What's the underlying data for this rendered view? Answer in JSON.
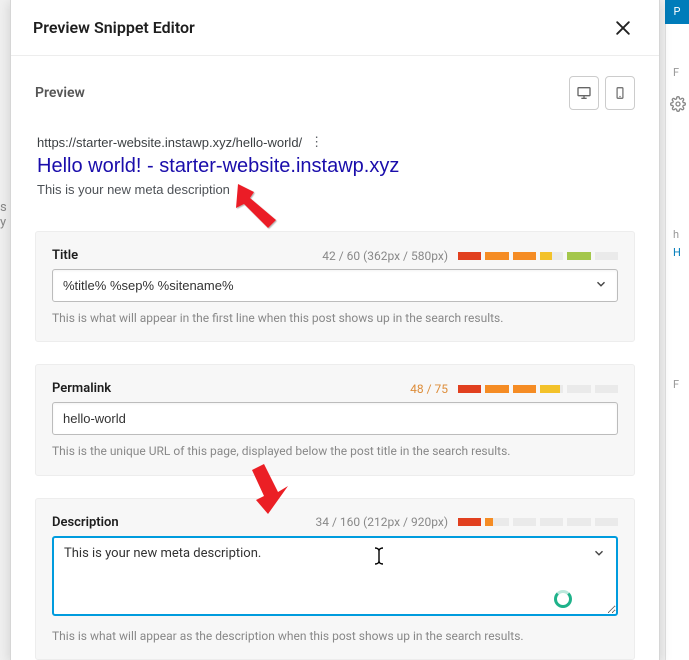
{
  "header": {
    "title": "Preview Snippet Editor"
  },
  "preview": {
    "heading": "Preview"
  },
  "serp": {
    "url": "https://starter-website.instawp.xyz/hello-world/",
    "title": "Hello world! - starter-website.instawp.xyz",
    "description": "This is your new meta description"
  },
  "title_panel": {
    "label": "Title",
    "count": "42 / 60 (362px / 580px)",
    "value": "%title% %sep% %sitename%",
    "help": "This is what will appear in the first line when this post shows up in the search results."
  },
  "permalink_panel": {
    "label": "Permalink",
    "count": "48 / 75",
    "value": "hello-world",
    "help": "This is the unique URL of this page, displayed below the post title in the search results."
  },
  "description_panel": {
    "label": "Description",
    "count": "34 / 160 (212px / 920px)",
    "value": "This is your new meta description.",
    "help": "This is what will appear as the description when this post shows up in the search results."
  },
  "bg": {
    "top_button": "P",
    "left_text": "s y",
    "side_h": "h",
    "side_H2": "H",
    "side_F1": "F",
    "side_F2": "F"
  }
}
